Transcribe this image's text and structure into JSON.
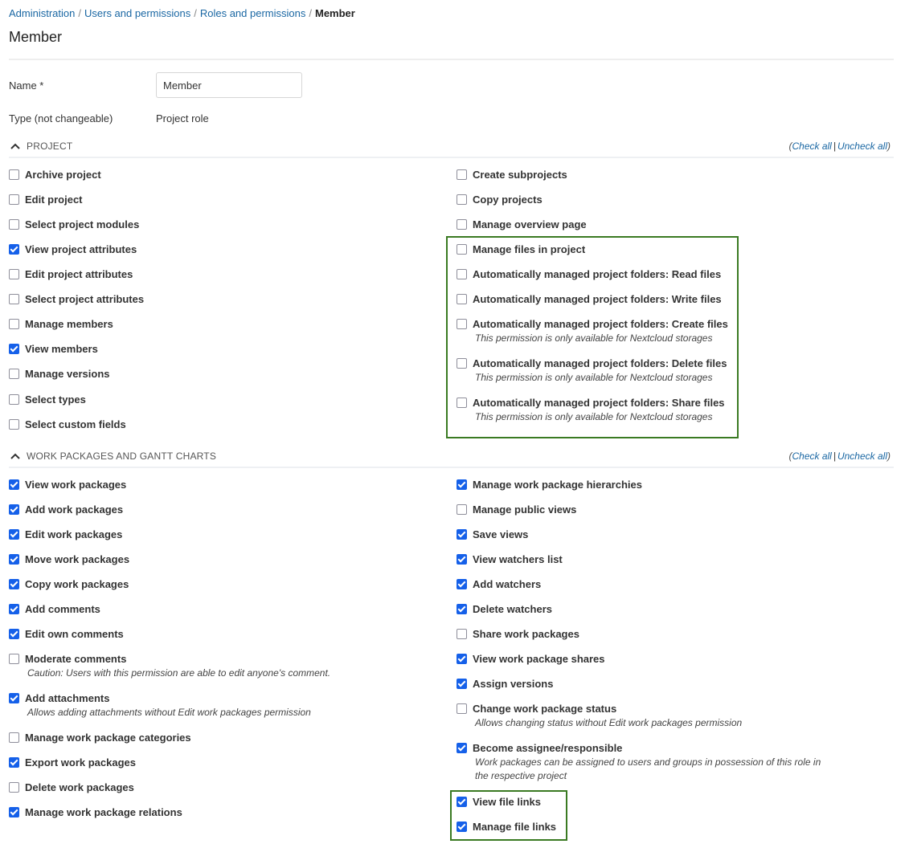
{
  "breadcrumb": {
    "items": [
      "Administration",
      "Users and permissions",
      "Roles and permissions"
    ],
    "separator": "/",
    "current": "Member"
  },
  "page": {
    "title": "Member"
  },
  "form": {
    "name_label": "Name *",
    "name_value": "Member",
    "type_label": "Type (not changeable)",
    "type_value": "Project role"
  },
  "check_links": {
    "open": "(",
    "check_all": "Check all",
    "bar": "|",
    "uncheck_all": "Uncheck all",
    "close": ")"
  },
  "sections": [
    {
      "title": "PROJECT",
      "left": [
        {
          "label": "Archive project",
          "checked": false
        },
        {
          "label": "Edit project",
          "checked": false
        },
        {
          "label": "Select project modules",
          "checked": false
        },
        {
          "label": "View project attributes",
          "checked": true
        },
        {
          "label": "Edit project attributes",
          "checked": false
        },
        {
          "label": "Select project attributes",
          "checked": false
        },
        {
          "label": "Manage members",
          "checked": false
        },
        {
          "label": "View members",
          "checked": true
        },
        {
          "label": "Manage versions",
          "checked": false
        },
        {
          "label": "Select types",
          "checked": false
        },
        {
          "label": "Select custom fields",
          "checked": false
        }
      ],
      "right": [
        {
          "label": "Create subprojects",
          "checked": false
        },
        {
          "label": "Copy projects",
          "checked": false
        },
        {
          "label": "Manage overview page",
          "checked": false
        },
        {
          "label": "Manage files in project",
          "checked": false
        },
        {
          "label": "Automatically managed project folders: Read files",
          "checked": false
        },
        {
          "label": "Automatically managed project folders: Write files",
          "checked": false
        },
        {
          "label": "Automatically managed project folders: Create files",
          "checked": false,
          "hint": "This permission is only available for Nextcloud storages"
        },
        {
          "label": "Automatically managed project folders: Delete files",
          "checked": false,
          "hint": "This permission is only available for Nextcloud storages"
        },
        {
          "label": "Automatically managed project folders: Share files",
          "checked": false,
          "hint": "This permission is only available for Nextcloud storages"
        }
      ]
    },
    {
      "title": "WORK PACKAGES AND GANTT CHARTS",
      "left": [
        {
          "label": "View work packages",
          "checked": true
        },
        {
          "label": "Add work packages",
          "checked": true
        },
        {
          "label": "Edit work packages",
          "checked": true
        },
        {
          "label": "Move work packages",
          "checked": true
        },
        {
          "label": "Copy work packages",
          "checked": true
        },
        {
          "label": "Add comments",
          "checked": true
        },
        {
          "label": "Edit own comments",
          "checked": true
        },
        {
          "label": "Moderate comments",
          "checked": false,
          "hint": "Caution: Users with this permission are able to edit anyone's comment."
        },
        {
          "label": "Add attachments",
          "checked": true,
          "hint": "Allows adding attachments without Edit work packages permission"
        },
        {
          "label": "Manage work package categories",
          "checked": false
        },
        {
          "label": "Export work packages",
          "checked": true
        },
        {
          "label": "Delete work packages",
          "checked": false
        },
        {
          "label": "Manage work package relations",
          "checked": true
        }
      ],
      "right": [
        {
          "label": "Manage work package hierarchies",
          "checked": true
        },
        {
          "label": "Manage public views",
          "checked": false
        },
        {
          "label": "Save views",
          "checked": true
        },
        {
          "label": "View watchers list",
          "checked": true
        },
        {
          "label": "Add watchers",
          "checked": true
        },
        {
          "label": "Delete watchers",
          "checked": true
        },
        {
          "label": "Share work packages",
          "checked": false
        },
        {
          "label": "View work package shares",
          "checked": true
        },
        {
          "label": "Assign versions",
          "checked": true
        },
        {
          "label": "Change work package status",
          "checked": false,
          "hint": "Allows changing status without Edit work packages permission"
        },
        {
          "label": "Become assignee/responsible",
          "checked": true,
          "hint": "Work packages can be assigned to users and groups in possession of this role in the respective project"
        },
        {
          "label": "View file links",
          "checked": true
        },
        {
          "label": "Manage file links",
          "checked": true
        }
      ]
    }
  ],
  "colors": {
    "link": "#1a67a3",
    "checkbox_checked": "#1560e9",
    "highlight_border": "#3a7a22"
  }
}
